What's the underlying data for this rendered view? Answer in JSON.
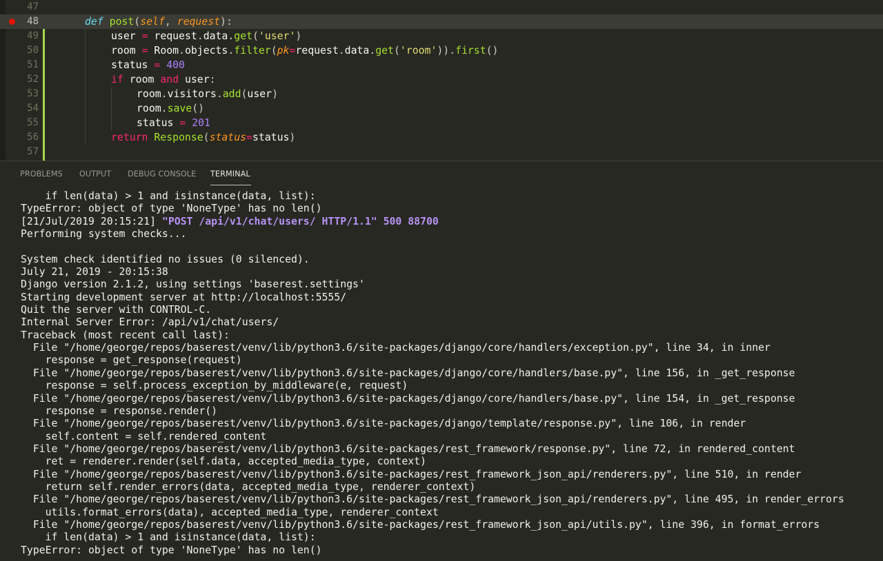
{
  "editor": {
    "lines": [
      {
        "num": "47"
      },
      {
        "num": "48"
      },
      {
        "num": "49"
      },
      {
        "num": "50"
      },
      {
        "num": "51"
      },
      {
        "num": "52"
      },
      {
        "num": "53"
      },
      {
        "num": "54"
      },
      {
        "num": "55"
      },
      {
        "num": "56"
      },
      {
        "num": "57"
      }
    ],
    "active_line": "48",
    "breakpoint_line": "48"
  },
  "panel": {
    "tabs": [
      "PROBLEMS",
      "OUTPUT",
      "DEBUG CONSOLE",
      "TERMINAL"
    ],
    "active_tab": "TERMINAL"
  },
  "terminal": {
    "lines": [
      "    if len(data) > 1 and isinstance(data, list):",
      "TypeError: object of type 'NoneType' has no len()",
      "[21/Jul/2019 20:15:21] ",
      "Performing system checks...",
      "",
      "System check identified no issues (0 silenced).",
      "July 21, 2019 - 20:15:38",
      "Django version 2.1.2, using settings 'baserest.settings'",
      "Starting development server at http://localhost:5555/",
      "Quit the server with CONTROL-C.",
      "Internal Server Error: /api/v1/chat/users/",
      "Traceback (most recent call last):",
      "  File \"/home/george/repos/baserest/venv/lib/python3.6/site-packages/django/core/handlers/exception.py\", line 34, in inner",
      "    response = get_response(request)",
      "  File \"/home/george/repos/baserest/venv/lib/python3.6/site-packages/django/core/handlers/base.py\", line 156, in _get_response",
      "    response = self.process_exception_by_middleware(e, request)",
      "  File \"/home/george/repos/baserest/venv/lib/python3.6/site-packages/django/core/handlers/base.py\", line 154, in _get_response",
      "    response = response.render()",
      "  File \"/home/george/repos/baserest/venv/lib/python3.6/site-packages/django/template/response.py\", line 106, in render",
      "    self.content = self.rendered_content",
      "  File \"/home/george/repos/baserest/venv/lib/python3.6/site-packages/rest_framework/response.py\", line 72, in rendered_content",
      "    ret = renderer.render(self.data, accepted_media_type, context)",
      "  File \"/home/george/repos/baserest/venv/lib/python3.6/site-packages/rest_framework_json_api/renderers.py\", line 510, in render",
      "    return self.render_errors(data, accepted_media_type, renderer_context)",
      "  File \"/home/george/repos/baserest/venv/lib/python3.6/site-packages/rest_framework_json_api/renderers.py\", line 495, in render_errors",
      "    utils.format_errors(data), accepted_media_type, renderer_context",
      "  File \"/home/george/repos/baserest/venv/lib/python3.6/site-packages/rest_framework_json_api/utils.py\", line 396, in format_errors",
      "    if len(data) > 1 and isinstance(data, list):",
      "TypeError: object of type 'NoneType' has no len()"
    ],
    "http_request": "\"POST /api/v1/chat/users/ HTTP/1.1\" 500 88700",
    "http_line_index": 2,
    "http_color": "#b792f5"
  },
  "colors": {
    "background": "#272822",
    "keyword": "#f92672",
    "function": "#a6e22e",
    "string": "#e6db74",
    "number": "#ae81ff",
    "parameter": "#fd971f",
    "def": "#66d9ef",
    "breakpoint": "#e51400",
    "git_added": "#a6d84e"
  }
}
